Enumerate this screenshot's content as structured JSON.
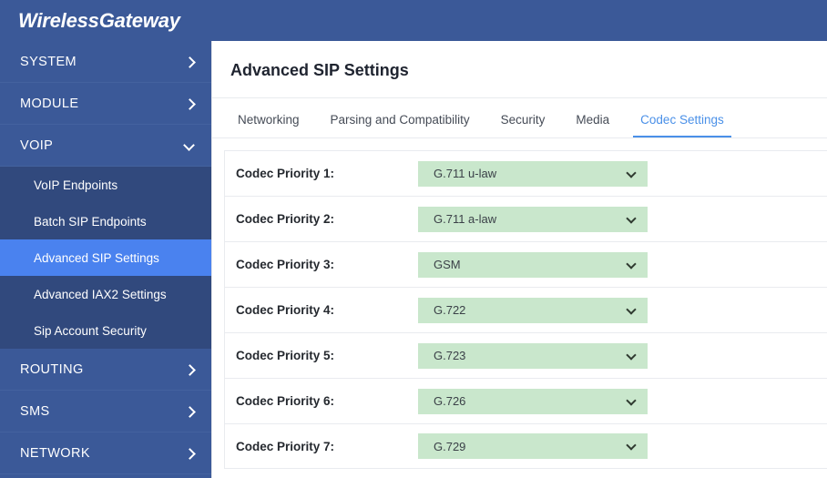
{
  "header": {
    "brand": "WirelessGateway"
  },
  "sidebar": {
    "groups": [
      {
        "label": "SYSTEM",
        "icon": "chevron-right-icon",
        "expanded": false
      },
      {
        "label": "MODULE",
        "icon": "chevron-right-icon",
        "expanded": false
      },
      {
        "label": "VOIP",
        "icon": "chevron-down-icon",
        "expanded": true
      },
      {
        "label": "ROUTING",
        "icon": "chevron-right-icon",
        "expanded": false
      },
      {
        "label": "SMS",
        "icon": "chevron-right-icon",
        "expanded": false
      },
      {
        "label": "NETWORK",
        "icon": "chevron-right-icon",
        "expanded": false
      }
    ],
    "voip_items": [
      {
        "label": "VoIP Endpoints",
        "active": false
      },
      {
        "label": "Batch SIP Endpoints",
        "active": false
      },
      {
        "label": "Advanced SIP Settings",
        "active": true
      },
      {
        "label": "Advanced IAX2 Settings",
        "active": false
      },
      {
        "label": "Sip Account Security",
        "active": false
      }
    ],
    "colors": {
      "background": "#3b5998",
      "subnav_background": "#31497d",
      "active_item": "#4a82ef"
    }
  },
  "main": {
    "page_title": "Advanced SIP Settings",
    "tabs": [
      {
        "label": "Networking",
        "active": false
      },
      {
        "label": "Parsing and Compatibility",
        "active": false
      },
      {
        "label": "Security",
        "active": false
      },
      {
        "label": "Media",
        "active": false
      },
      {
        "label": "Codec Settings",
        "active": true
      }
    ],
    "tab_active_color": "#4a90e8",
    "select_background": "#c9e7cc",
    "rows": [
      {
        "label": "Codec Priority 1:",
        "value": "G.711 u-law",
        "icon": "chevron-down-icon"
      },
      {
        "label": "Codec Priority 2:",
        "value": "G.711 a-law",
        "icon": "chevron-down-icon"
      },
      {
        "label": "Codec Priority 3:",
        "value": "GSM",
        "icon": "chevron-down-icon"
      },
      {
        "label": "Codec Priority 4:",
        "value": "G.722",
        "icon": "chevron-down-icon"
      },
      {
        "label": "Codec Priority 5:",
        "value": "G.723",
        "icon": "chevron-down-icon"
      },
      {
        "label": "Codec Priority 6:",
        "value": "G.726",
        "icon": "chevron-down-icon"
      },
      {
        "label": "Codec Priority 7:",
        "value": "G.729",
        "icon": "chevron-down-icon"
      }
    ]
  }
}
